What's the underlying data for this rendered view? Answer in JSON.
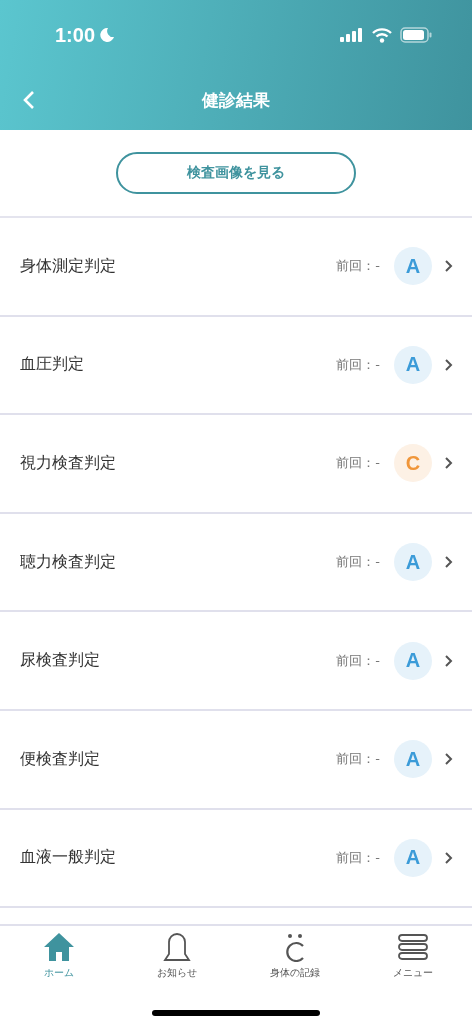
{
  "status_bar": {
    "time": "1:00"
  },
  "nav": {
    "title": "健診結果"
  },
  "image_button": {
    "label": "検査画像を見る"
  },
  "results": [
    {
      "name": "身体測定判定",
      "previous": "前回：-",
      "grade": "A",
      "color": "#3b9bd8"
    },
    {
      "name": "血圧判定",
      "previous": "前回：-",
      "grade": "A",
      "color": "#3b9bd8"
    },
    {
      "name": "視力検査判定",
      "previous": "前回：-",
      "grade": "C",
      "color": "#f0963a"
    },
    {
      "name": "聴力検査判定",
      "previous": "前回：-",
      "grade": "A",
      "color": "#3b9bd8"
    },
    {
      "name": "尿検査判定",
      "previous": "前回：-",
      "grade": "A",
      "color": "#3b9bd8"
    },
    {
      "name": "便検査判定",
      "previous": "前回：-",
      "grade": "A",
      "color": "#3b9bd8"
    },
    {
      "name": "血液一般判定",
      "previous": "前回：-",
      "grade": "A",
      "color": "#3b9bd8"
    }
  ],
  "tab_bar": [
    {
      "kind": "home",
      "label": "ホーム",
      "selected": true
    },
    {
      "kind": "bell",
      "label": "お知らせ",
      "selected": false
    },
    {
      "kind": "body",
      "label": "身体の記録",
      "selected": false
    },
    {
      "kind": "menu",
      "label": "メニュー",
      "selected": false
    }
  ]
}
